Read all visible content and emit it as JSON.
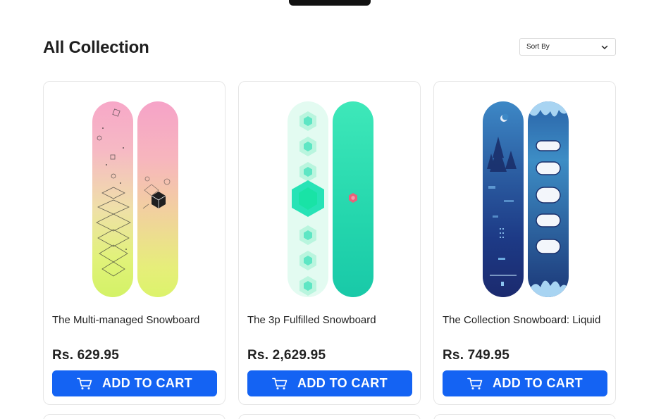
{
  "header": {
    "title": "All Collection",
    "sort_label": "Sort By"
  },
  "products": [
    {
      "name": "The Multi-managed Snowboard",
      "price": "Rs. 629.95",
      "button": "ADD TO CART"
    },
    {
      "name": "The 3p Fulfilled Snowboard",
      "price": "Rs. 2,629.95",
      "button": "ADD TO CART"
    },
    {
      "name": "The Collection Snowboard: Liquid",
      "price": "Rs. 749.95",
      "button": "ADD TO CART"
    }
  ],
  "colors": {
    "accent": "#1463f3",
    "text": "#222222",
    "border": "#e6e6e6"
  },
  "icons": {
    "cart": "cart-icon",
    "sort": "chevron-down-icon"
  }
}
